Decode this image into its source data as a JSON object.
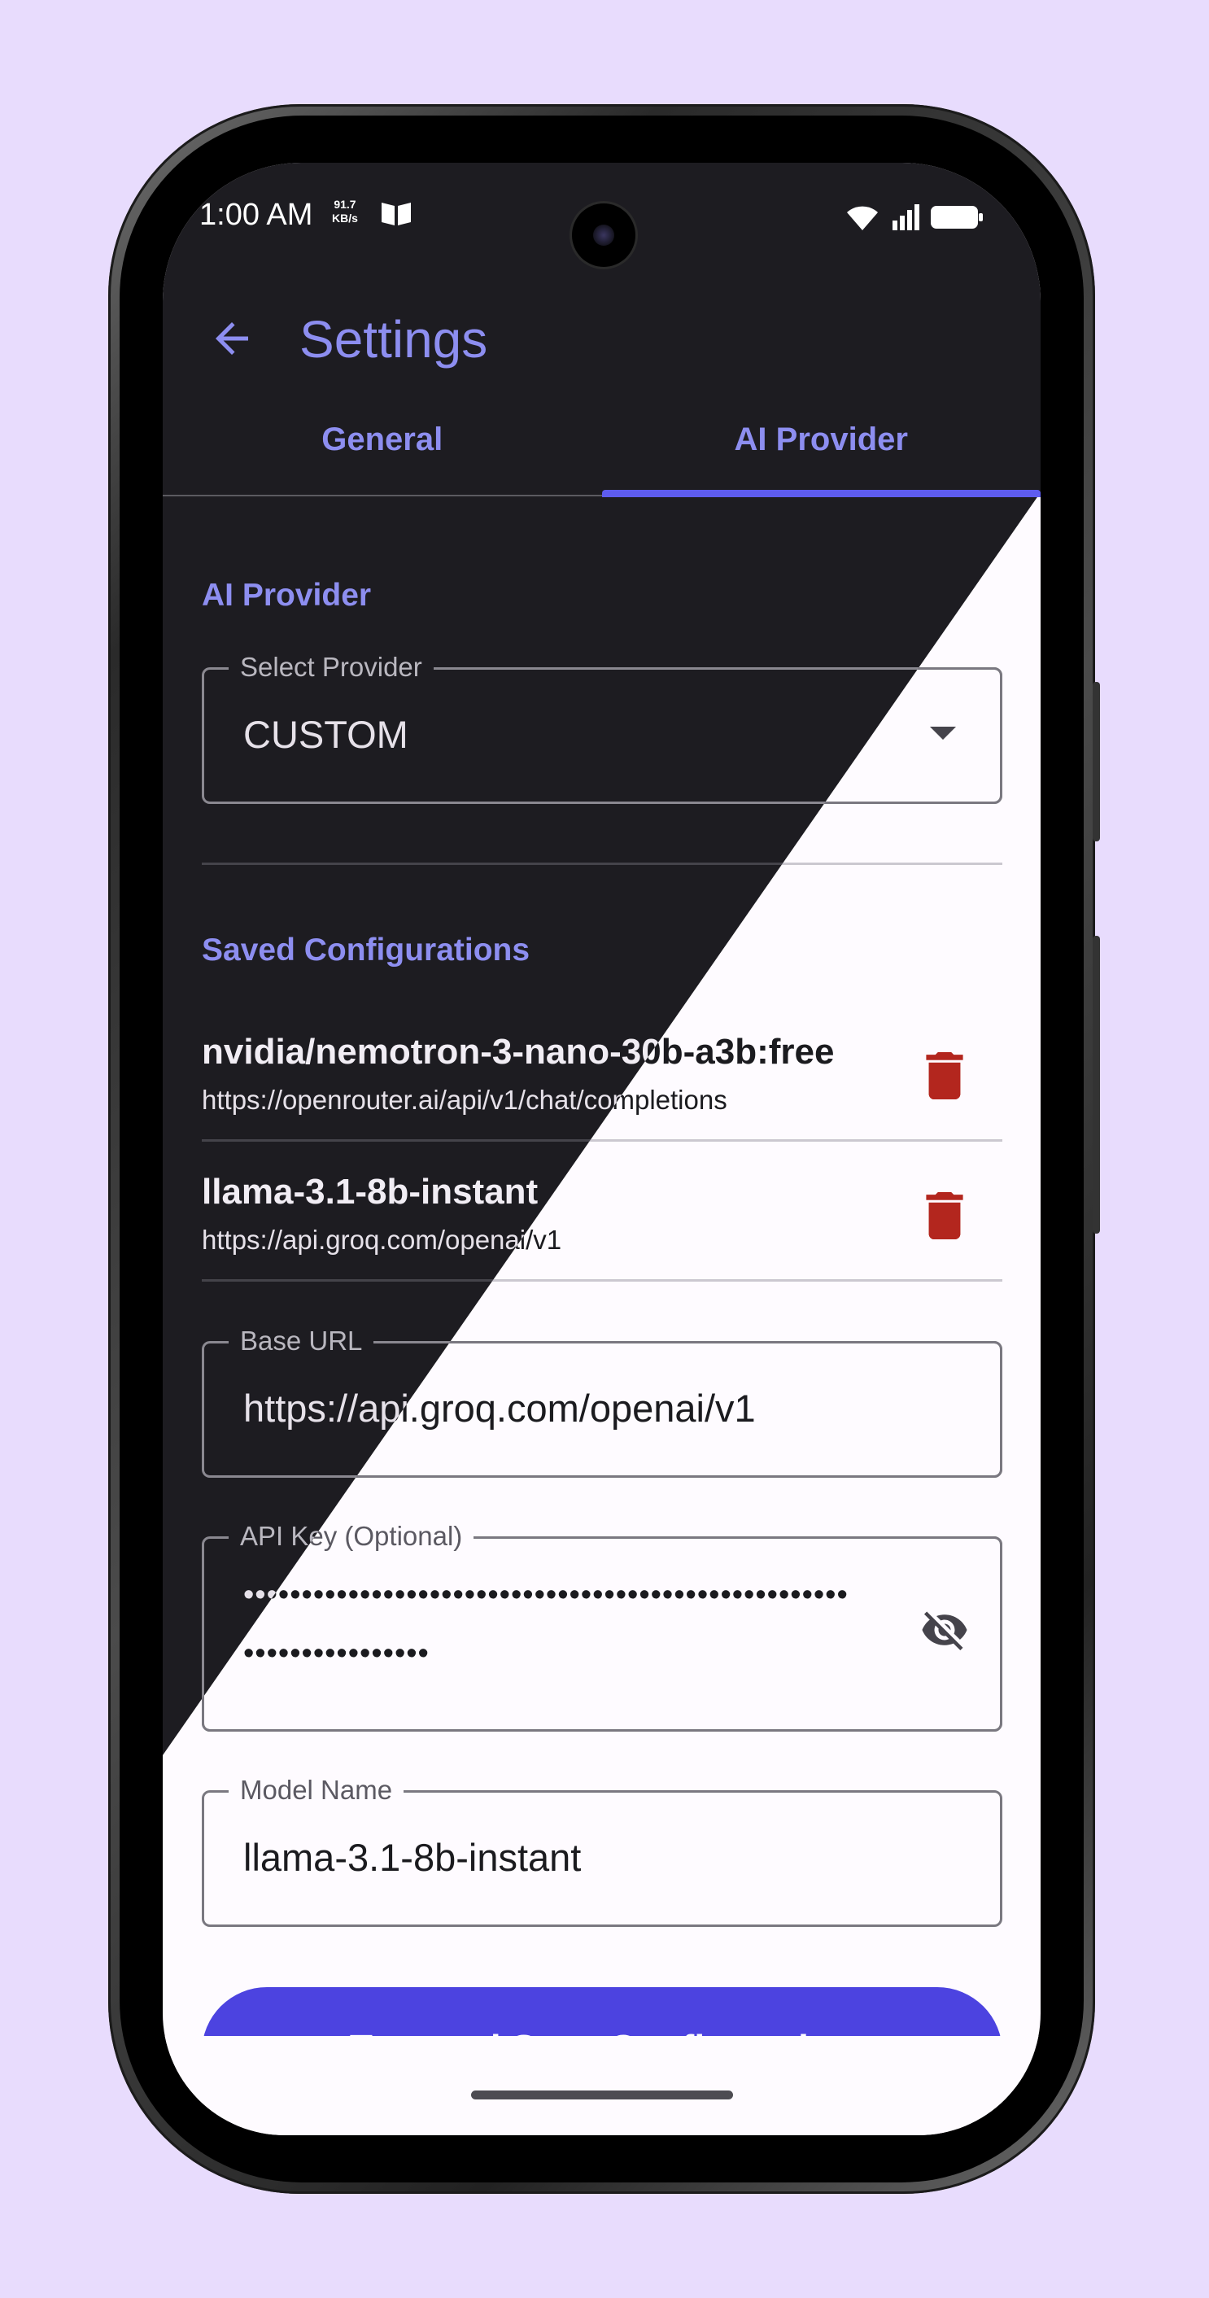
{
  "status_bar": {
    "time": "1:00 AM",
    "speed_value": "91.7",
    "speed_unit": "KB/s"
  },
  "app_bar": {
    "title": "Settings",
    "back_icon": "arrow-back-icon"
  },
  "tabs": [
    {
      "label": "General",
      "selected": false
    },
    {
      "label": "AI Provider",
      "selected": true
    }
  ],
  "ai_provider": {
    "section_title": "AI Provider",
    "select_label": "Select Provider",
    "select_value": "CUSTOM"
  },
  "saved": {
    "section_title": "Saved Configurations",
    "items": [
      {
        "name": "nvidia/nemotron-3-nano-30b-a3b:free",
        "url": "https://openrouter.ai/api/v1/chat/completions"
      },
      {
        "name": "llama-3.1-8b-instant",
        "url": "https://api.groq.com/openai/v1"
      }
    ]
  },
  "form": {
    "base_url_label": "Base URL",
    "base_url_value": "https://api.groq.com/openai/v1",
    "api_key_label": "API Key (Optional)",
    "api_key_line1": "••••••••••••••••••••••••••••••••••••••••••••••••••••",
    "api_key_line2": "••••••••••••••••",
    "model_label": "Model Name",
    "model_value": "llama-3.1-8b-instant"
  },
  "primary_button": {
    "label": "Test and Save Configuration"
  },
  "colors": {
    "background": "#e8dcfd",
    "accent": "#8d8ef0",
    "button": "#4c43e0",
    "delete": "#b3261e"
  }
}
